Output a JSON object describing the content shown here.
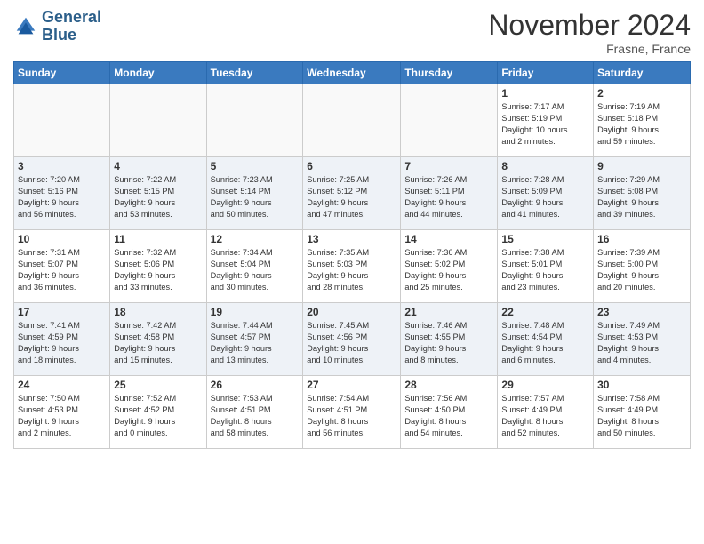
{
  "header": {
    "logo_line1": "General",
    "logo_line2": "Blue",
    "month_title": "November 2024",
    "location": "Frasne, France"
  },
  "weekdays": [
    "Sunday",
    "Monday",
    "Tuesday",
    "Wednesday",
    "Thursday",
    "Friday",
    "Saturday"
  ],
  "weeks": [
    [
      {
        "day": "",
        "info": ""
      },
      {
        "day": "",
        "info": ""
      },
      {
        "day": "",
        "info": ""
      },
      {
        "day": "",
        "info": ""
      },
      {
        "day": "",
        "info": ""
      },
      {
        "day": "1",
        "info": "Sunrise: 7:17 AM\nSunset: 5:19 PM\nDaylight: 10 hours\nand 2 minutes."
      },
      {
        "day": "2",
        "info": "Sunrise: 7:19 AM\nSunset: 5:18 PM\nDaylight: 9 hours\nand 59 minutes."
      }
    ],
    [
      {
        "day": "3",
        "info": "Sunrise: 7:20 AM\nSunset: 5:16 PM\nDaylight: 9 hours\nand 56 minutes."
      },
      {
        "day": "4",
        "info": "Sunrise: 7:22 AM\nSunset: 5:15 PM\nDaylight: 9 hours\nand 53 minutes."
      },
      {
        "day": "5",
        "info": "Sunrise: 7:23 AM\nSunset: 5:14 PM\nDaylight: 9 hours\nand 50 minutes."
      },
      {
        "day": "6",
        "info": "Sunrise: 7:25 AM\nSunset: 5:12 PM\nDaylight: 9 hours\nand 47 minutes."
      },
      {
        "day": "7",
        "info": "Sunrise: 7:26 AM\nSunset: 5:11 PM\nDaylight: 9 hours\nand 44 minutes."
      },
      {
        "day": "8",
        "info": "Sunrise: 7:28 AM\nSunset: 5:09 PM\nDaylight: 9 hours\nand 41 minutes."
      },
      {
        "day": "9",
        "info": "Sunrise: 7:29 AM\nSunset: 5:08 PM\nDaylight: 9 hours\nand 39 minutes."
      }
    ],
    [
      {
        "day": "10",
        "info": "Sunrise: 7:31 AM\nSunset: 5:07 PM\nDaylight: 9 hours\nand 36 minutes."
      },
      {
        "day": "11",
        "info": "Sunrise: 7:32 AM\nSunset: 5:06 PM\nDaylight: 9 hours\nand 33 minutes."
      },
      {
        "day": "12",
        "info": "Sunrise: 7:34 AM\nSunset: 5:04 PM\nDaylight: 9 hours\nand 30 minutes."
      },
      {
        "day": "13",
        "info": "Sunrise: 7:35 AM\nSunset: 5:03 PM\nDaylight: 9 hours\nand 28 minutes."
      },
      {
        "day": "14",
        "info": "Sunrise: 7:36 AM\nSunset: 5:02 PM\nDaylight: 9 hours\nand 25 minutes."
      },
      {
        "day": "15",
        "info": "Sunrise: 7:38 AM\nSunset: 5:01 PM\nDaylight: 9 hours\nand 23 minutes."
      },
      {
        "day": "16",
        "info": "Sunrise: 7:39 AM\nSunset: 5:00 PM\nDaylight: 9 hours\nand 20 minutes."
      }
    ],
    [
      {
        "day": "17",
        "info": "Sunrise: 7:41 AM\nSunset: 4:59 PM\nDaylight: 9 hours\nand 18 minutes."
      },
      {
        "day": "18",
        "info": "Sunrise: 7:42 AM\nSunset: 4:58 PM\nDaylight: 9 hours\nand 15 minutes."
      },
      {
        "day": "19",
        "info": "Sunrise: 7:44 AM\nSunset: 4:57 PM\nDaylight: 9 hours\nand 13 minutes."
      },
      {
        "day": "20",
        "info": "Sunrise: 7:45 AM\nSunset: 4:56 PM\nDaylight: 9 hours\nand 10 minutes."
      },
      {
        "day": "21",
        "info": "Sunrise: 7:46 AM\nSunset: 4:55 PM\nDaylight: 9 hours\nand 8 minutes."
      },
      {
        "day": "22",
        "info": "Sunrise: 7:48 AM\nSunset: 4:54 PM\nDaylight: 9 hours\nand 6 minutes."
      },
      {
        "day": "23",
        "info": "Sunrise: 7:49 AM\nSunset: 4:53 PM\nDaylight: 9 hours\nand 4 minutes."
      }
    ],
    [
      {
        "day": "24",
        "info": "Sunrise: 7:50 AM\nSunset: 4:53 PM\nDaylight: 9 hours\nand 2 minutes."
      },
      {
        "day": "25",
        "info": "Sunrise: 7:52 AM\nSunset: 4:52 PM\nDaylight: 9 hours\nand 0 minutes."
      },
      {
        "day": "26",
        "info": "Sunrise: 7:53 AM\nSunset: 4:51 PM\nDaylight: 8 hours\nand 58 minutes."
      },
      {
        "day": "27",
        "info": "Sunrise: 7:54 AM\nSunset: 4:51 PM\nDaylight: 8 hours\nand 56 minutes."
      },
      {
        "day": "28",
        "info": "Sunrise: 7:56 AM\nSunset: 4:50 PM\nDaylight: 8 hours\nand 54 minutes."
      },
      {
        "day": "29",
        "info": "Sunrise: 7:57 AM\nSunset: 4:49 PM\nDaylight: 8 hours\nand 52 minutes."
      },
      {
        "day": "30",
        "info": "Sunrise: 7:58 AM\nSunset: 4:49 PM\nDaylight: 8 hours\nand 50 minutes."
      }
    ]
  ]
}
